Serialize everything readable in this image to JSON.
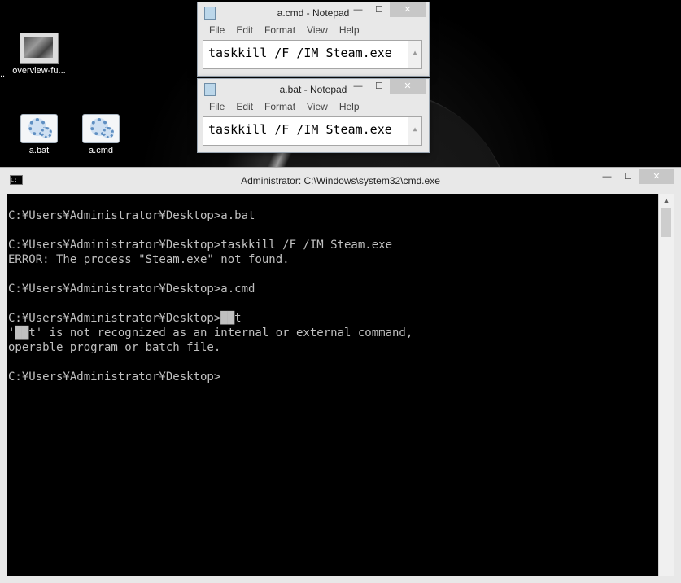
{
  "desktop": {
    "icons": [
      {
        "label": "overview-fu..."
      },
      {
        "label": "a.bat"
      },
      {
        "label": "a.cmd"
      }
    ],
    "ellipsis": ".."
  },
  "notepad_cmd": {
    "title": "a.cmd - Notepad",
    "menu": [
      "File",
      "Edit",
      "Format",
      "View",
      "Help"
    ],
    "content": "taskkill /F /IM Steam.exe"
  },
  "notepad_bat": {
    "title": "a.bat - Notepad",
    "menu": [
      "File",
      "Edit",
      "Format",
      "View",
      "Help"
    ],
    "content": "taskkill /F /IM Steam.exe"
  },
  "cmd_window": {
    "title": "Administrator: C:\\Windows\\system32\\cmd.exe",
    "lines": [
      "C:¥Users¥Administrator¥Desktop>a.bat",
      "",
      "C:¥Users¥Administrator¥Desktop>taskkill /F /IM Steam.exe",
      "ERROR: The process \"Steam.exe\" not found.",
      "",
      "C:¥Users¥Administrator¥Desktop>a.cmd",
      "",
      "C:¥Users¥Administrator¥Desktop>██t",
      "'██t' is not recognized as an internal or external command,",
      "operable program or batch file.",
      "",
      "C:¥Users¥Administrator¥Desktop>"
    ]
  },
  "controls": {
    "minimize": "—",
    "maximize": "☐",
    "close": "✕"
  }
}
